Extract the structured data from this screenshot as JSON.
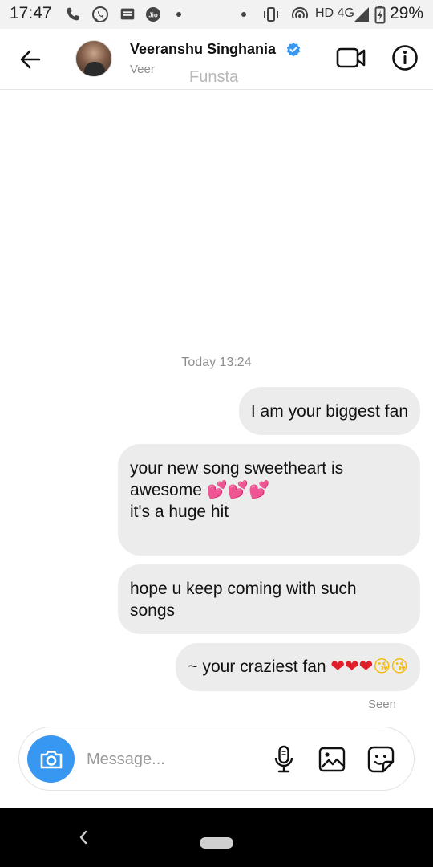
{
  "status_bar": {
    "time": "17:47",
    "network": "HD 4G",
    "battery": "29%",
    "icons": [
      "phone-icon",
      "whatsapp-icon",
      "message-icon",
      "jio-icon",
      "dot-icon",
      "dot-icon",
      "vibrate-icon",
      "hotspot-icon",
      "signal-icon",
      "battery-icon"
    ]
  },
  "header": {
    "name": "Veeranshu Singhania",
    "username": "Veer",
    "watermark": "Funsta",
    "verified": true,
    "icons": [
      "back-arrow-icon",
      "verified-badge-icon",
      "video-call-icon",
      "info-icon"
    ]
  },
  "conversation": {
    "timestamp": "Today 13:24",
    "messages": [
      {
        "lines": [
          "I am your biggest fan"
        ]
      },
      {
        "lines": [
          "your new song sweetheart is",
          "awesome",
          "it's a huge hit"
        ],
        "emoji": "💕💕💕"
      },
      {
        "lines": [
          "hope u keep coming with such",
          "songs"
        ]
      },
      {
        "text": "~ your craziest fan",
        "emoji_hearts": "❤❤❤",
        "emoji_kiss": "😘😘"
      }
    ],
    "seen_label": "Seen"
  },
  "composer": {
    "placeholder": "Message...",
    "icons": [
      "camera-icon",
      "microphone-icon",
      "gallery-icon",
      "sticker-icon"
    ]
  },
  "colors": {
    "accent_blue": "#3897f0",
    "bubble_bg": "#ececec",
    "verified_blue": "#3897f0"
  }
}
